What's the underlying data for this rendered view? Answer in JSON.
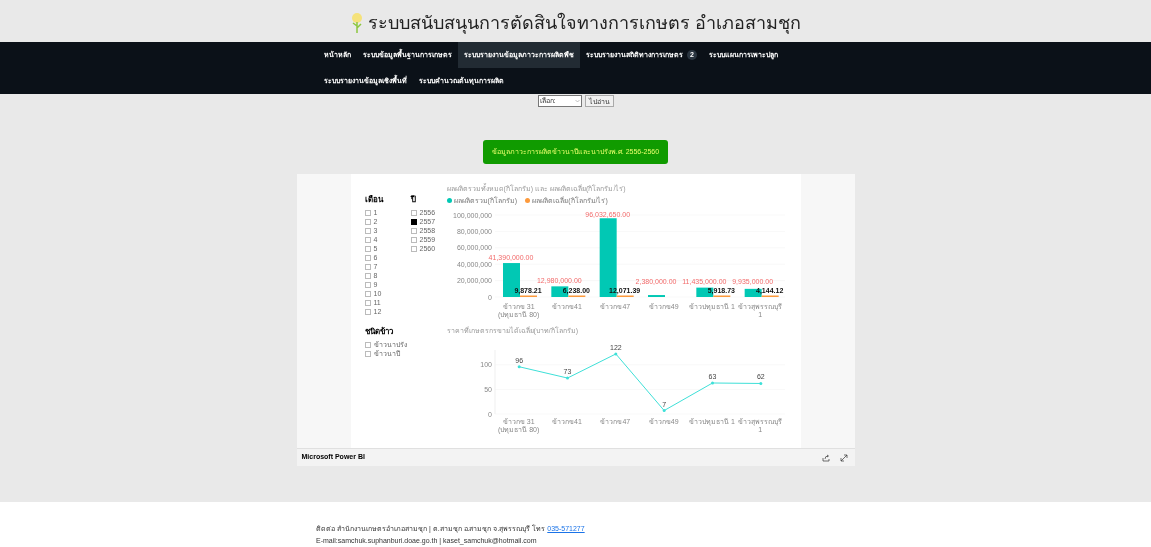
{
  "header": {
    "title": "ระบบสนับสนุนการตัดสินใจทางการเกษตร อำเภอสามชุก"
  },
  "nav": {
    "rows": [
      [
        {
          "label": "หน้าหลัก",
          "selected": false
        },
        {
          "label": "ระบบข้อมูลพื้นฐานการเกษตร",
          "selected": false
        },
        {
          "label": "ระบบรายงานข้อมูลภาวะการผลิตพืช",
          "selected": true
        },
        {
          "label": "ระบบรายงานสถิติทางการเกษตร",
          "selected": false,
          "badge": "2"
        },
        {
          "label": "ระบบแผนการเพาะปลูก",
          "selected": false
        }
      ],
      [
        {
          "label": "ระบบรายงานข้อมูลเชิงพื้นที่",
          "selected": false
        },
        {
          "label": "ระบบคำนวณต้นทุนการผลิต",
          "selected": false
        }
      ]
    ]
  },
  "jump": {
    "select": "เลือก:",
    "button": "ไปอ่าน"
  },
  "banner_button": "ข้อมูลภาวะการผลิตข้าวนาปีและนาปรังพ.ศ. 2556-2560",
  "report": {
    "month_slicer": {
      "title": "เดือน",
      "items": [
        {
          "label": "1",
          "checked": false
        },
        {
          "label": "2",
          "checked": false
        },
        {
          "label": "3",
          "checked": false
        },
        {
          "label": "4",
          "checked": false
        },
        {
          "label": "5",
          "checked": false
        },
        {
          "label": "6",
          "checked": false
        },
        {
          "label": "7",
          "checked": false
        },
        {
          "label": "8",
          "checked": false
        },
        {
          "label": "9",
          "checked": false
        },
        {
          "label": "10",
          "checked": false
        },
        {
          "label": "11",
          "checked": false
        },
        {
          "label": "12",
          "checked": false
        }
      ]
    },
    "year_slicer": {
      "title": "ปี",
      "items": [
        {
          "label": "2556",
          "checked": false
        },
        {
          "label": "2557",
          "checked": true
        },
        {
          "label": "2558",
          "checked": false
        },
        {
          "label": "2559",
          "checked": false
        },
        {
          "label": "2560",
          "checked": false
        }
      ]
    },
    "production_chart": {
      "chart_data": {
        "type": "bar",
        "title": "ผลผลิตรวมทั้งหมด(กิโลกรัม) และ ผลผลิตเฉลี่ย(กิโลกรัม/ไร่)",
        "legend": "top",
        "categories": [
          "ข้าวกข 31 (ปทุมธานี 80)",
          "ข้าวกข41",
          "ข้าวกข47",
          "ข้าวกข49",
          "ข้าวปทุมธานี 1",
          "ข้าวสุพรรณบุรี 1"
        ],
        "series": [
          {
            "name": "ผลผลิตรวม(กิโลกรัม)",
            "color": "#01c8b4",
            "values": [
              41390000,
              12980000,
              96032650,
              2380000,
              11435000,
              9935000
            ],
            "value_labels": [
              "41,390,000.00",
              "12,980,000.00",
              "96,032,650.00",
              "2,380,000.00",
              "11,435,000.00",
              "9,935,000.00"
            ]
          },
          {
            "name": "ผลผลิตเฉลี่ย(กิโลกรัม/ไร่)",
            "color": "#fd9a3c",
            "values": [
              9878.21,
              6238,
              12071.39,
              null,
              5918.73,
              4144.12
            ],
            "value_labels": [
              "9,878.21",
              "6,238.00",
              "12,071.39",
              null,
              "5,918.73",
              "4,144.12"
            ]
          }
        ],
        "ylim": [
          0,
          100000000
        ],
        "yticks": [
          {
            "value": 0,
            "label": "0"
          },
          {
            "value": 20000000,
            "label": "20,000,000"
          },
          {
            "value": 40000000,
            "label": "40,000,000"
          },
          {
            "value": 60000000,
            "label": "60,000,000"
          },
          {
            "value": 80000000,
            "label": "80,000,000"
          },
          {
            "value": 100000000,
            "label": "100,000,000"
          }
        ]
      }
    },
    "rice_slicer": {
      "title": "ชนิดข้าว",
      "items": [
        {
          "label": "ข้าวนาปรัง",
          "checked": false
        },
        {
          "label": "ข้าวนาปี",
          "checked": false
        }
      ]
    },
    "price_chart": {
      "chart_data": {
        "type": "line",
        "title": "ราคาที่เกษตรกรขายได้เฉลี่ย(บาท/กิโลกรัม)",
        "categories": [
          "ข้าวกข 31 (ปทุมธานี 80)",
          "ข้าวกข41",
          "ข้าวกข47",
          "ข้าวกข49",
          "ข้าวปทุมธานี 1",
          "ข้าวสุพรรณบุรี 1"
        ],
        "series": [
          {
            "color": "#3ee0d8",
            "values": [
              96,
              73,
              122,
              7,
              63,
              62
            ],
            "value_labels": [
              "96",
              "73",
              "122",
              "7",
              "63",
              "62"
            ]
          }
        ],
        "ylim": [
          0,
          130
        ],
        "yticks": [
          0,
          50,
          100
        ]
      }
    },
    "footer_bar": {
      "label": "Microsoft Power BI"
    }
  },
  "footer": {
    "contact": "ติดต่อ สำนักงานเกษตรอำเภอสามชุก | ต.สามชุก อ.สามชุก จ.สุพรรณบุรี โทร ",
    "phone": "035-571277",
    "email": "E-mail:samchuk.suphanburi.doae.go.th | kaset_samchuk@hotmail.com"
  }
}
